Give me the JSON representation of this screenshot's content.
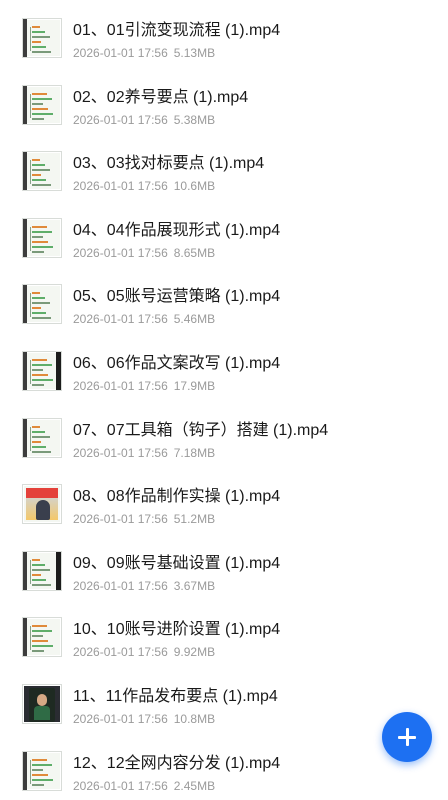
{
  "files": [
    {
      "name": "01、01引流变现流程 (1).mp4",
      "date": "2026-01-01 17:56",
      "size": "5.13MB",
      "thumb": "mindmap"
    },
    {
      "name": "02、02养号要点 (1).mp4",
      "date": "2026-01-01 17:56",
      "size": "5.38MB",
      "thumb": "mindmap"
    },
    {
      "name": "03、03找对标要点 (1).mp4",
      "date": "2026-01-01 17:56",
      "size": "10.6MB",
      "thumb": "mindmap"
    },
    {
      "name": "04、04作品展现形式 (1).mp4",
      "date": "2026-01-01 17:56",
      "size": "8.65MB",
      "thumb": "mindmap"
    },
    {
      "name": "05、05账号运营策略 (1).mp4",
      "date": "2026-01-01 17:56",
      "size": "5.46MB",
      "thumb": "mindmap"
    },
    {
      "name": "06、06作品文案改写 (1).mp4",
      "date": "2026-01-01 17:56",
      "size": "17.9MB",
      "thumb": "mindmap-dark"
    },
    {
      "name": "07、07工具箱（钩子）搭建 (1).mp4",
      "date": "2026-01-01 17:56",
      "size": "7.18MB",
      "thumb": "mindmap"
    },
    {
      "name": "08、08作品制作实操 (1).mp4",
      "date": "2026-01-01 17:56",
      "size": "51.2MB",
      "thumb": "poster"
    },
    {
      "name": "09、09账号基础设置 (1).mp4",
      "date": "2026-01-01 17:56",
      "size": "3.67MB",
      "thumb": "mindmap-dark"
    },
    {
      "name": "10、10账号进阶设置 (1).mp4",
      "date": "2026-01-01 17:56",
      "size": "9.92MB",
      "thumb": "mindmap"
    },
    {
      "name": "11、11作品发布要点 (1).mp4",
      "date": "2026-01-01 17:56",
      "size": "10.8MB",
      "thumb": "phone"
    },
    {
      "name": "12、12全网内容分发 (1).mp4",
      "date": "2026-01-01 17:56",
      "size": "2.45MB",
      "thumb": "mindmap"
    }
  ],
  "fab": {
    "icon": "plus-icon",
    "color": "#1d70f2"
  }
}
